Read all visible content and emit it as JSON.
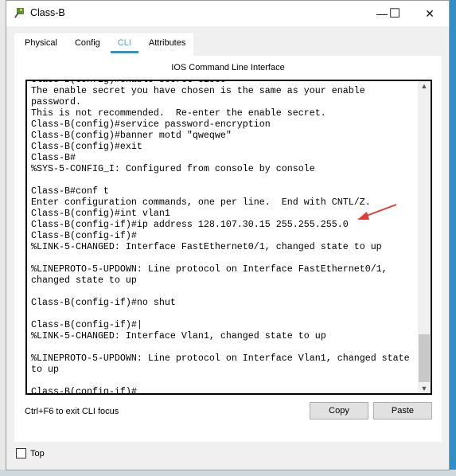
{
  "window": {
    "title": "Class-B",
    "minimize": "—",
    "maximize": "☐",
    "close": "✕"
  },
  "tabs": [
    {
      "label": "Physical"
    },
    {
      "label": "Config"
    },
    {
      "label": "CLI",
      "active": true
    },
    {
      "label": "Attributes"
    }
  ],
  "cli": {
    "title": "IOS Command Line Interface",
    "lines": [
      "Class-B(config)#enable secret cisco",
      "The enable secret you have chosen is the same as your enable",
      "password.",
      "This is not recommended.  Re-enter the enable secret.",
      "Class-B(config)#service password-encryption",
      "Class-B(config)#banner motd \"qweqwe\"",
      "Class-B(config)#exit",
      "Class-B#",
      "%SYS-5-CONFIG_I: Configured from console by console",
      "",
      "Class-B#conf t",
      "Enter configuration commands, one per line.  End with CNTL/Z.",
      "Class-B(config)#int vlan1",
      "Class-B(config-if)#ip address 128.107.30.15 255.255.255.0",
      "Class-B(config-if)#",
      "%LINK-5-CHANGED: Interface FastEthernet0/1, changed state to up",
      "",
      "%LINEPROTO-5-UPDOWN: Line protocol on Interface FastEthernet0/1,",
      "changed state to up",
      "",
      "Class-B(config-if)#no shut",
      "",
      "Class-B(config-if)#|",
      "%LINK-5-CHANGED: Interface Vlan1, changed state to up",
      "",
      "%LINEPROTO-5-UPDOWN: Line protocol on Interface Vlan1, changed state",
      "to up",
      "",
      "Class-B(config-if)#"
    ],
    "hint": "Ctrl+F6 to exit CLI focus",
    "copy_label": "Copy",
    "paste_label": "Paste"
  },
  "top_checkbox": {
    "label": "Top",
    "checked": false
  },
  "annotation": {
    "color": "#e53935",
    "icon": "red-arrow"
  }
}
